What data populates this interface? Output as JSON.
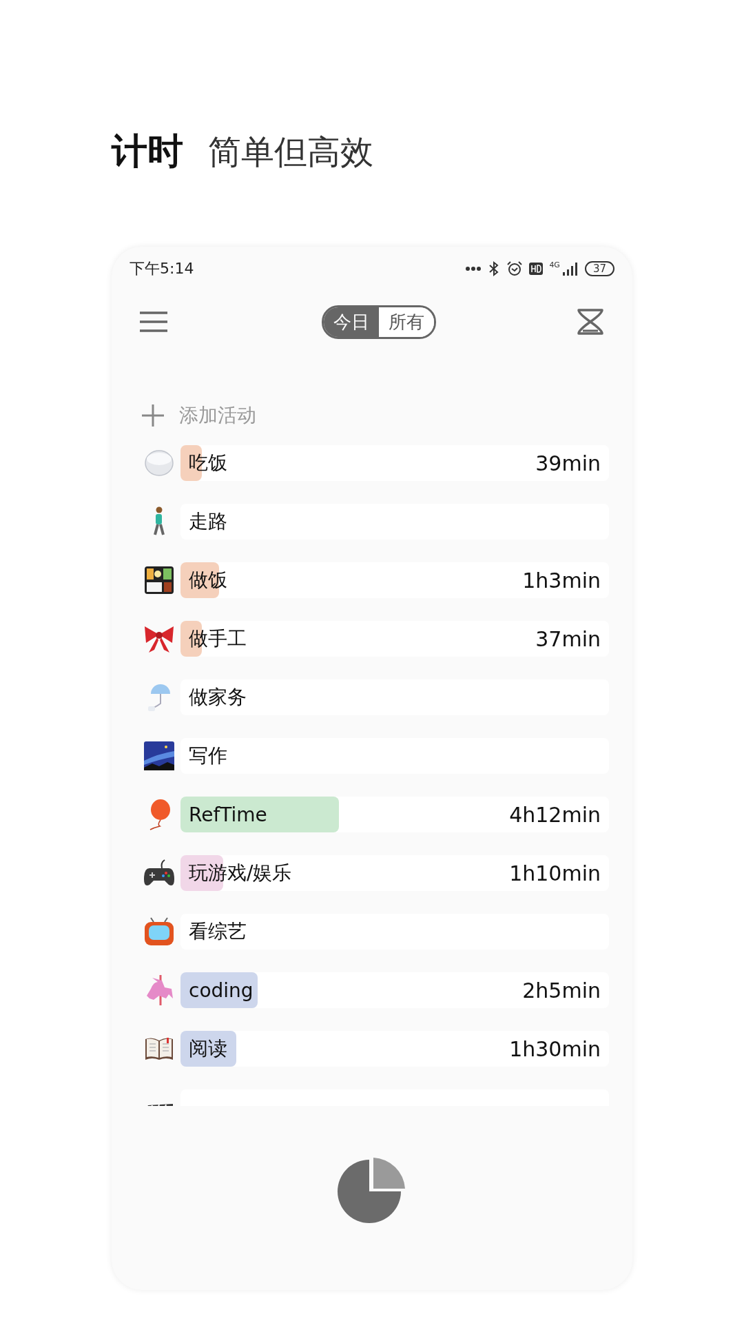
{
  "headline": {
    "title": "计时",
    "subtitle": "简单但高效"
  },
  "status_bar": {
    "time": "下午5:14",
    "network": "4G",
    "battery": "37"
  },
  "tabs": [
    {
      "label": "今日",
      "selected": true
    },
    {
      "label": "所有",
      "selected": false
    }
  ],
  "add_activity": {
    "label": "添加活动"
  },
  "activities": [
    {
      "name": "吃饭",
      "time": "39min",
      "level": 0.05,
      "color": "#f5d0bb"
    },
    {
      "name": "走路"
    },
    {
      "name": "做饭",
      "time": "1h3min",
      "level": 0.09,
      "color": "#f5d0bb"
    },
    {
      "name": "做手工",
      "time": "37min",
      "level": 0.05,
      "color": "#f5d0bb"
    },
    {
      "name": "做家务"
    },
    {
      "name": "写作"
    },
    {
      "name": "RefTime",
      "time": "4h12min",
      "level": 0.37,
      "color": "#cbe9d0"
    },
    {
      "name": "玩游戏/娱乐",
      "time": "1h10min",
      "level": 0.1,
      "color": "#f1d7e8"
    },
    {
      "name": "看综艺"
    },
    {
      "name": "coding",
      "time": "2h5min",
      "level": 0.18,
      "color": "#cdd6ec"
    },
    {
      "name": "阅读",
      "time": "1h30min",
      "level": 0.13,
      "color": "#cdd6ec"
    }
  ]
}
